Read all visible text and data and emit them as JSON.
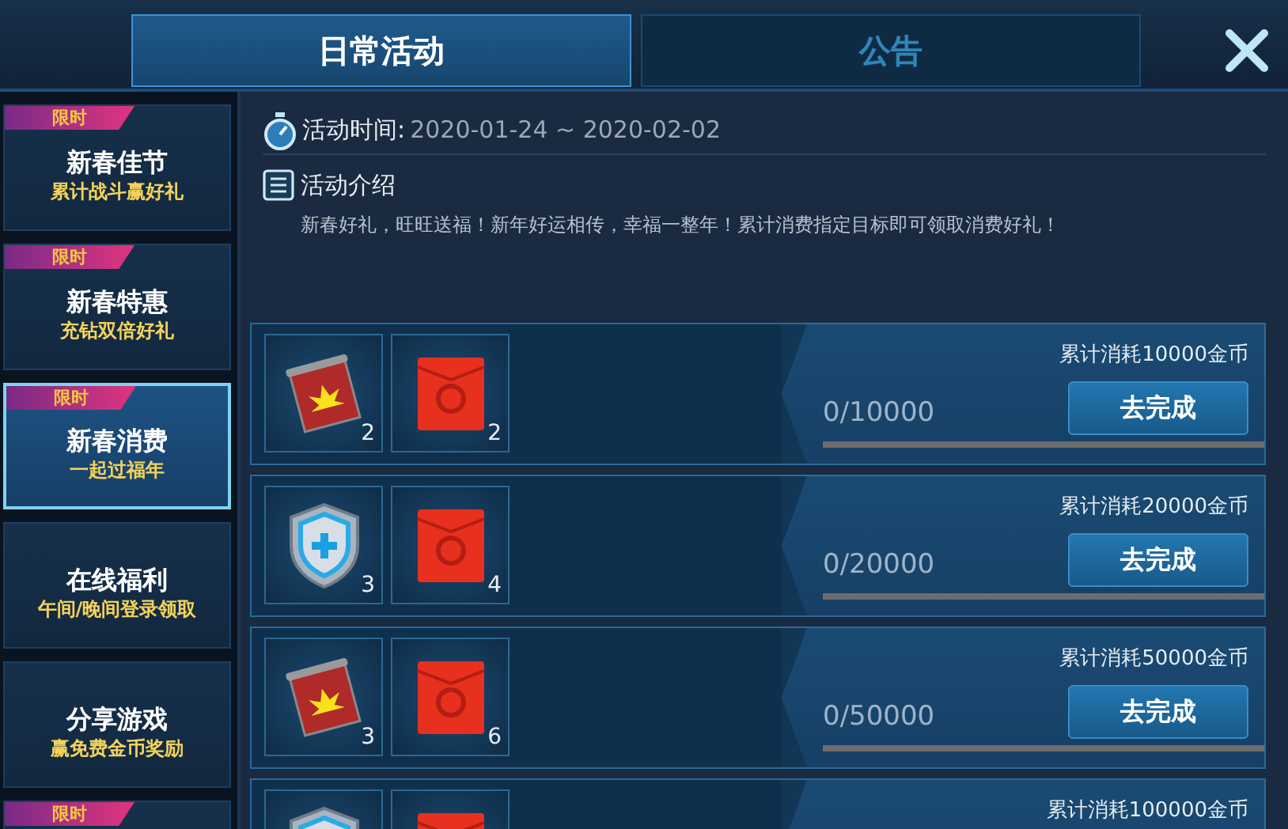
{
  "tabs": [
    {
      "label": "日常活动",
      "selected": true
    },
    {
      "label": "公告",
      "selected": false
    }
  ],
  "sidebar": {
    "items": [
      {
        "tag": "限时",
        "title": "新春佳节",
        "subtitle": "累计战斗赢好礼",
        "selected": false
      },
      {
        "tag": "限时",
        "title": "新春特惠",
        "subtitle": "充钻双倍好礼",
        "selected": false
      },
      {
        "tag": "限时",
        "title": "新春消费",
        "subtitle": "一起过福年",
        "selected": true
      },
      {
        "title": "在线福利",
        "subtitle": "午间/晚间登录领取",
        "selected": false
      },
      {
        "title": "分享游戏",
        "subtitle": "赢免费金币奖励",
        "selected": false
      },
      {
        "tag": "限时",
        "selected": false
      }
    ]
  },
  "activity": {
    "time_label": "活动时间:",
    "time_range": "2020-01-24 ~ 2020-02-02",
    "intro_title": "活动介绍",
    "intro_text": "新春好礼，旺旺送福！新年好运相传，幸福一整年！累计消费指定目标即可领取消费好礼！"
  },
  "tasks": [
    {
      "rewards": [
        {
          "kind": "scroll",
          "count": "2"
        },
        {
          "kind": "redbox",
          "count": "2"
        }
      ],
      "goal": "累计消耗10000金币",
      "progress": "0/10000",
      "level": 0,
      "button": "去完成"
    },
    {
      "rewards": [
        {
          "kind": "shield",
          "count": "3"
        },
        {
          "kind": "redbox",
          "count": "4"
        }
      ],
      "goal": "累计消耗20000金币",
      "progress": "0/20000",
      "level": 0,
      "button": "去完成"
    },
    {
      "rewards": [
        {
          "kind": "scroll",
          "count": "3"
        },
        {
          "kind": "redbox",
          "count": "6"
        }
      ],
      "goal": "累计消耗50000金币",
      "progress": "0/50000",
      "level": 0,
      "button": "去完成"
    },
    {
      "rewards": [
        {
          "kind": "shield"
        },
        {
          "kind": "redbox"
        }
      ],
      "goal": "累计消耗100000金币"
    }
  ]
}
